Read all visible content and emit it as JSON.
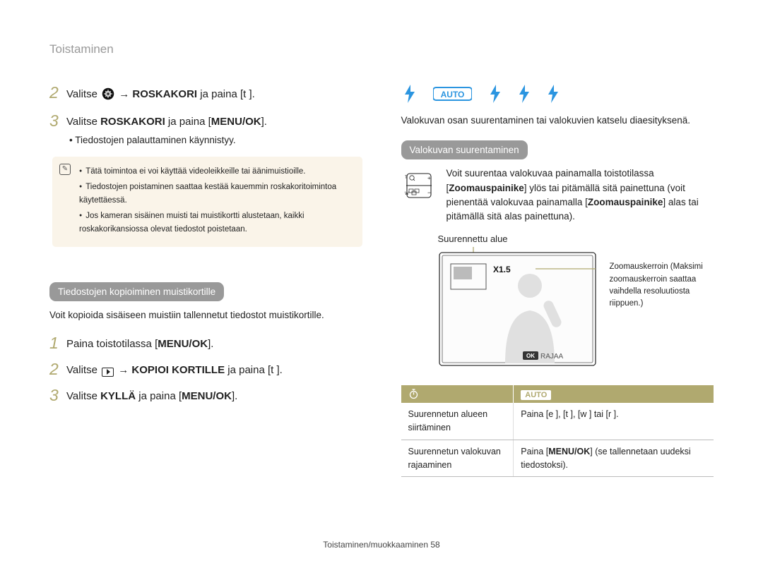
{
  "page": {
    "header": "Toistaminen",
    "footer": "Toistaminen/muokkaaminen  58"
  },
  "left": {
    "step2": {
      "pre": "Valitse ",
      "bold": "ROSKAKORI",
      "post": " ja paina [t     ]."
    },
    "step3": {
      "pre": "Valitse ",
      "bold1": "ROSKAKORI",
      "mid": " ja paina [",
      "bold2": "MENU/OK",
      "post": "]."
    },
    "sub_bullet": "Tiedostojen palauttaminen käynnistyy.",
    "note": [
      "Tätä toimintoa ei voi käyttää videoleikkeille tai äänimuistioille.",
      "Tiedostojen poistaminen saattaa kestää kauemmin roskakoritoimintoa käytettäessä.",
      "Jos kameran sisäinen muisti tai muistikortti alustetaan, kaikki roskakorikansiossa olevat tiedostot poistetaan."
    ],
    "section_pill": "Tiedostojen kopioiminen muistikortille",
    "section_desc": "Voit kopioida sisäiseen muistiin tallennetut tiedostot muistikortille.",
    "copy_step1": {
      "pre": "Paina toistotilassa [",
      "bold": "MENU/OK",
      "post": "]."
    },
    "copy_step2": {
      "pre": "Valitse ",
      "bold": "KOPIOI KORTILLE",
      "post": " ja paina [t      ]."
    },
    "copy_step3": {
      "pre": "Valitse ",
      "bold1": "KYLLÄ",
      "mid": " ja paina [",
      "bold2": "MENU/OK",
      "post": "]."
    }
  },
  "right": {
    "flash_row": true,
    "intro": "Valokuvan osan suurentaminen tai valokuvien katselu diaesityksenä.",
    "section_pill": "Valokuvan suurentaminen",
    "zoom_desc": "Voit suurentaa valokuvaa painamalla toistotilassa [<b>Zoomauspainike</b>] ylös tai pitämällä sitä painettuna (voit pienentää valokuvaa painamalla [<b>Zoomauspainike</b>] alas tai pitämällä sitä alas painettuna).",
    "enlarged_caption": "Suurennettu alue",
    "lcd_zoom_label": "X1.5",
    "lcd_crop_label": "RAJAA",
    "lcd_side": "Zoomauskerroin (Maksimi zoomauskerroin saattaa vaihdella resoluutiosta riippuen.)",
    "table": {
      "head2": "AUTO",
      "rows": [
        {
          "c1": "Suurennetun alueen siirtäminen",
          "c2": "Paina [e   ], [t    ], [w    ] tai [r    ]."
        },
        {
          "c1": "Suurennetun valokuvan rajaaminen",
          "c2_pre": "Paina [",
          "c2_bold": "MENU/OK",
          "c2_post": "] (se tallennetaan uudeksi tiedostoksi)."
        }
      ]
    }
  }
}
